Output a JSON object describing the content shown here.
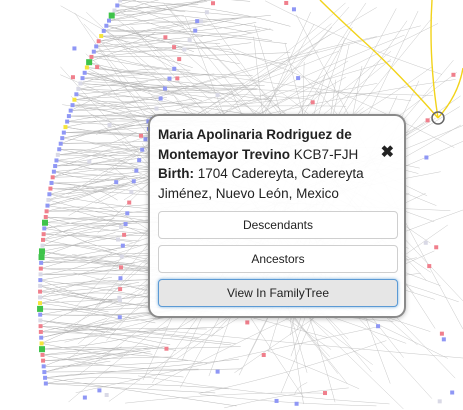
{
  "popup": {
    "name": "Maria Apolinaria Rodriguez de Montemayor Trevino",
    "id": "KCB7-FJH",
    "birth_label": "Birth:",
    "birth_value": "1704 Cadereyta, Cadereyta Jiménez, Nuevo León, Mexico",
    "close_icon": "close-icon",
    "buttons": {
      "descendants": "Descendants",
      "ancestors": "Ancestors",
      "view_in_familytree": "View In FamilyTree"
    }
  },
  "tree": {
    "link_color": "#b9b9b9",
    "highlight_link_color": "#f2d31a",
    "node_colors": {
      "male": "#8f97f5",
      "female": "#f07f8c",
      "green": "#3ec34a",
      "yellow": "#f5e53b",
      "gray": "#d9d9e6"
    }
  }
}
